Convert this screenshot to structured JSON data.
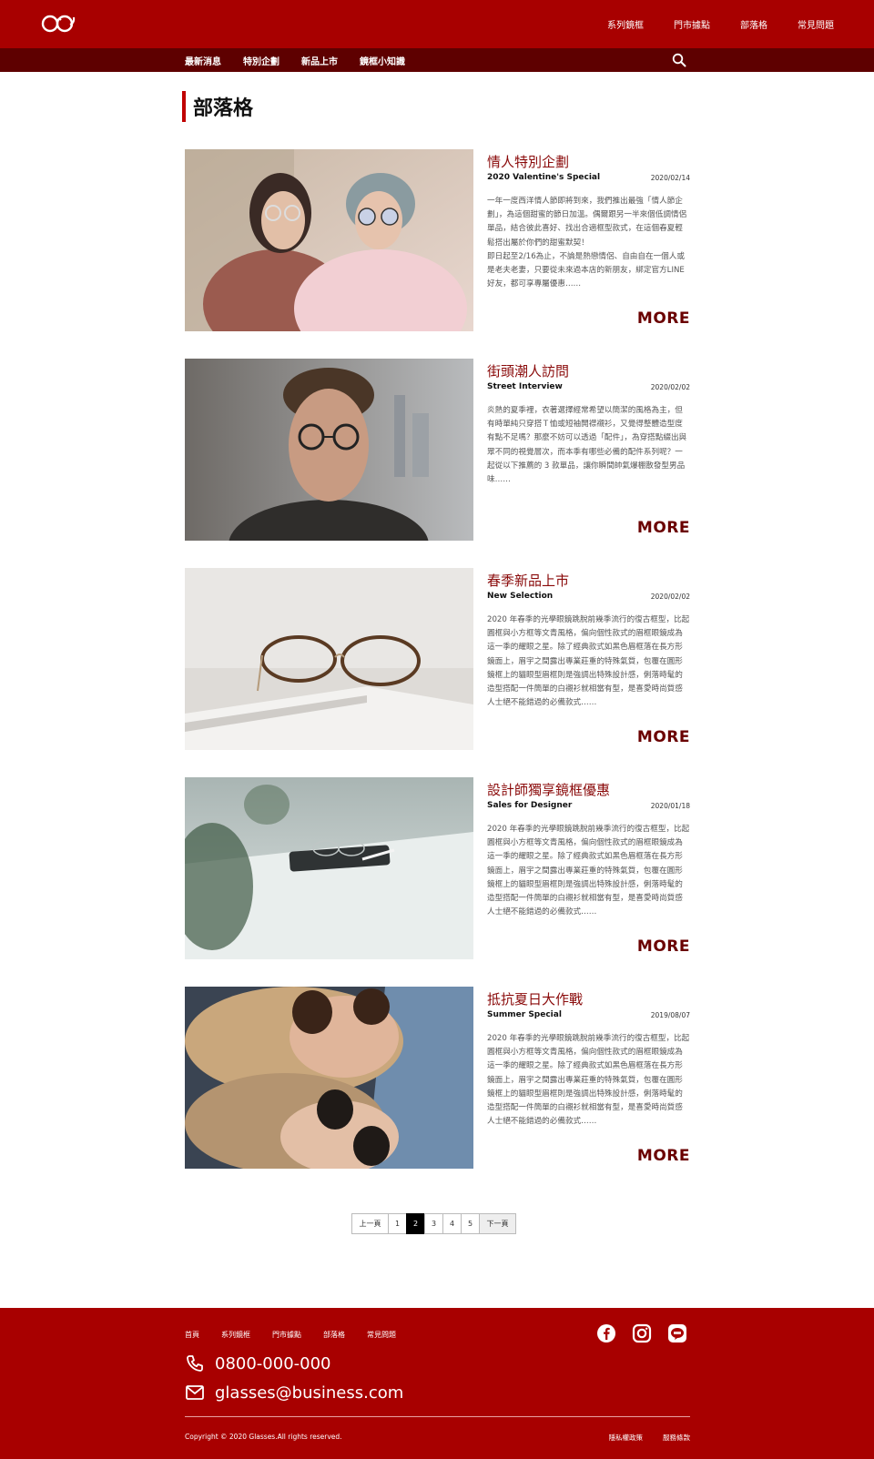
{
  "header": {
    "nav": [
      "系列鏡框",
      "門市據點",
      "部落格",
      "常見問題"
    ],
    "subnav": [
      "最新消息",
      "特別企劃",
      "新品上市",
      "鏡框小知識"
    ]
  },
  "page": {
    "title": "部落格"
  },
  "posts": [
    {
      "title": "情人特別企劃",
      "subtitle": "2020 Valentine's Special",
      "date": "2020/02/14",
      "body": "一年一度西洋情人節即將到來，我們推出最強「情人節企劃」，為這個甜蜜的節日加溫。偶爾跟另一半來個低調情侶單品，結合彼此喜好、找出合適框型款式，在這個春夏輕鬆搭出屬於你們的甜蜜默契！\n即日起至2/16為止，不論是熱戀情侶、自由自在一個人或是老夫老妻，只要從未來過本店的新朋友，綁定官方LINE好友，都可享專屬優惠……",
      "more": "MORE"
    },
    {
      "title": "街頭潮人訪問",
      "subtitle": "Street Interview",
      "date": "2020/02/02",
      "body": "炎熱的夏季裡，衣著選擇經常希望以簡潔的風格為主，但有時單純只穿搭Ｔ恤或短袖開襟襯衫，又覺得整體造型度有點不足嗎？那麼不妨可以透過「配件」，為穿搭點綴出與眾不同的視覺層次，而本季有哪些必備的配件系列呢？一起從以下推薦的 3 款單品，讓你瞬間帥氣爆棚散發型男品味……",
      "more": "MORE"
    },
    {
      "title": "春季新品上市",
      "subtitle": "New Selection",
      "date": "2020/02/02",
      "body": "2020 年春季的光學眼鏡跳脫前幾季流行的復古框型，比起圓框與小方框等文青風格，偏向個性款式的眉框眼鏡成為這一季的耀眼之星。除了經典款式如黑色眉框落在長方形鏡面上，眉宇之間露出專業莊重的特殊氣質，包覆在圓形鏡框上的貓眼型眉框則是強調出特殊設計感，俐落時髦的造型搭配一件簡單的白襯衫就相當有型，是喜愛時尚質感人士絕不能錯過的必備款式……",
      "more": "MORE"
    },
    {
      "title": "設計師獨享鏡框優惠",
      "subtitle": "Sales for Designer",
      "date": "2020/01/18",
      "body": "2020 年春季的光學眼鏡跳脫前幾季流行的復古框型，比起圓框與小方框等文青風格，偏向個性款式的眉框眼鏡成為這一季的耀眼之星。除了經典款式如黑色眉框落在長方形鏡面上，眉宇之間露出專業莊重的特殊氣質，包覆在圓形鏡框上的貓眼型眉框則是強調出特殊設計感，俐落時髦的造型搭配一件簡單的白襯衫就相當有型，是喜愛時尚質感人士絕不能錯過的必備款式……",
      "more": "MORE"
    },
    {
      "title": "抵抗夏日大作戰",
      "subtitle": "Summer Special",
      "date": "2019/08/07",
      "body": "2020 年春季的光學眼鏡跳脫前幾季流行的復古框型，比起圓框與小方框等文青風格，偏向個性款式的眉框眼鏡成為這一季的耀眼之星。除了經典款式如黑色眉框落在長方形鏡面上，眉宇之間露出專業莊重的特殊氣質，包覆在圓形鏡框上的貓眼型眉框則是強調出特殊設計感，俐落時髦的造型搭配一件簡單的白襯衫就相當有型，是喜愛時尚質感人士絕不能錯過的必備款式……",
      "more": "MORE"
    }
  ],
  "pagination": {
    "prev": "上一頁",
    "pages": [
      "1",
      "2",
      "3",
      "4",
      "5"
    ],
    "current": "2",
    "next": "下一頁"
  },
  "footer": {
    "nav": [
      "首頁",
      "系列鏡框",
      "門市據點",
      "部落格",
      "常見問題"
    ],
    "social": [
      "facebook-icon",
      "instagram-icon",
      "line-icon"
    ],
    "phone": "0800-000-000",
    "email": "glasses@business.com",
    "copyright": "Copyright © 2020 Glasses.All rights reserved.",
    "legal": [
      "隱私權政策",
      "服務條款"
    ]
  },
  "colors": {
    "brand": "#a80000",
    "subbar": "#5e0000",
    "accent_title": "#8a0a0a",
    "more": "#6a0000"
  }
}
